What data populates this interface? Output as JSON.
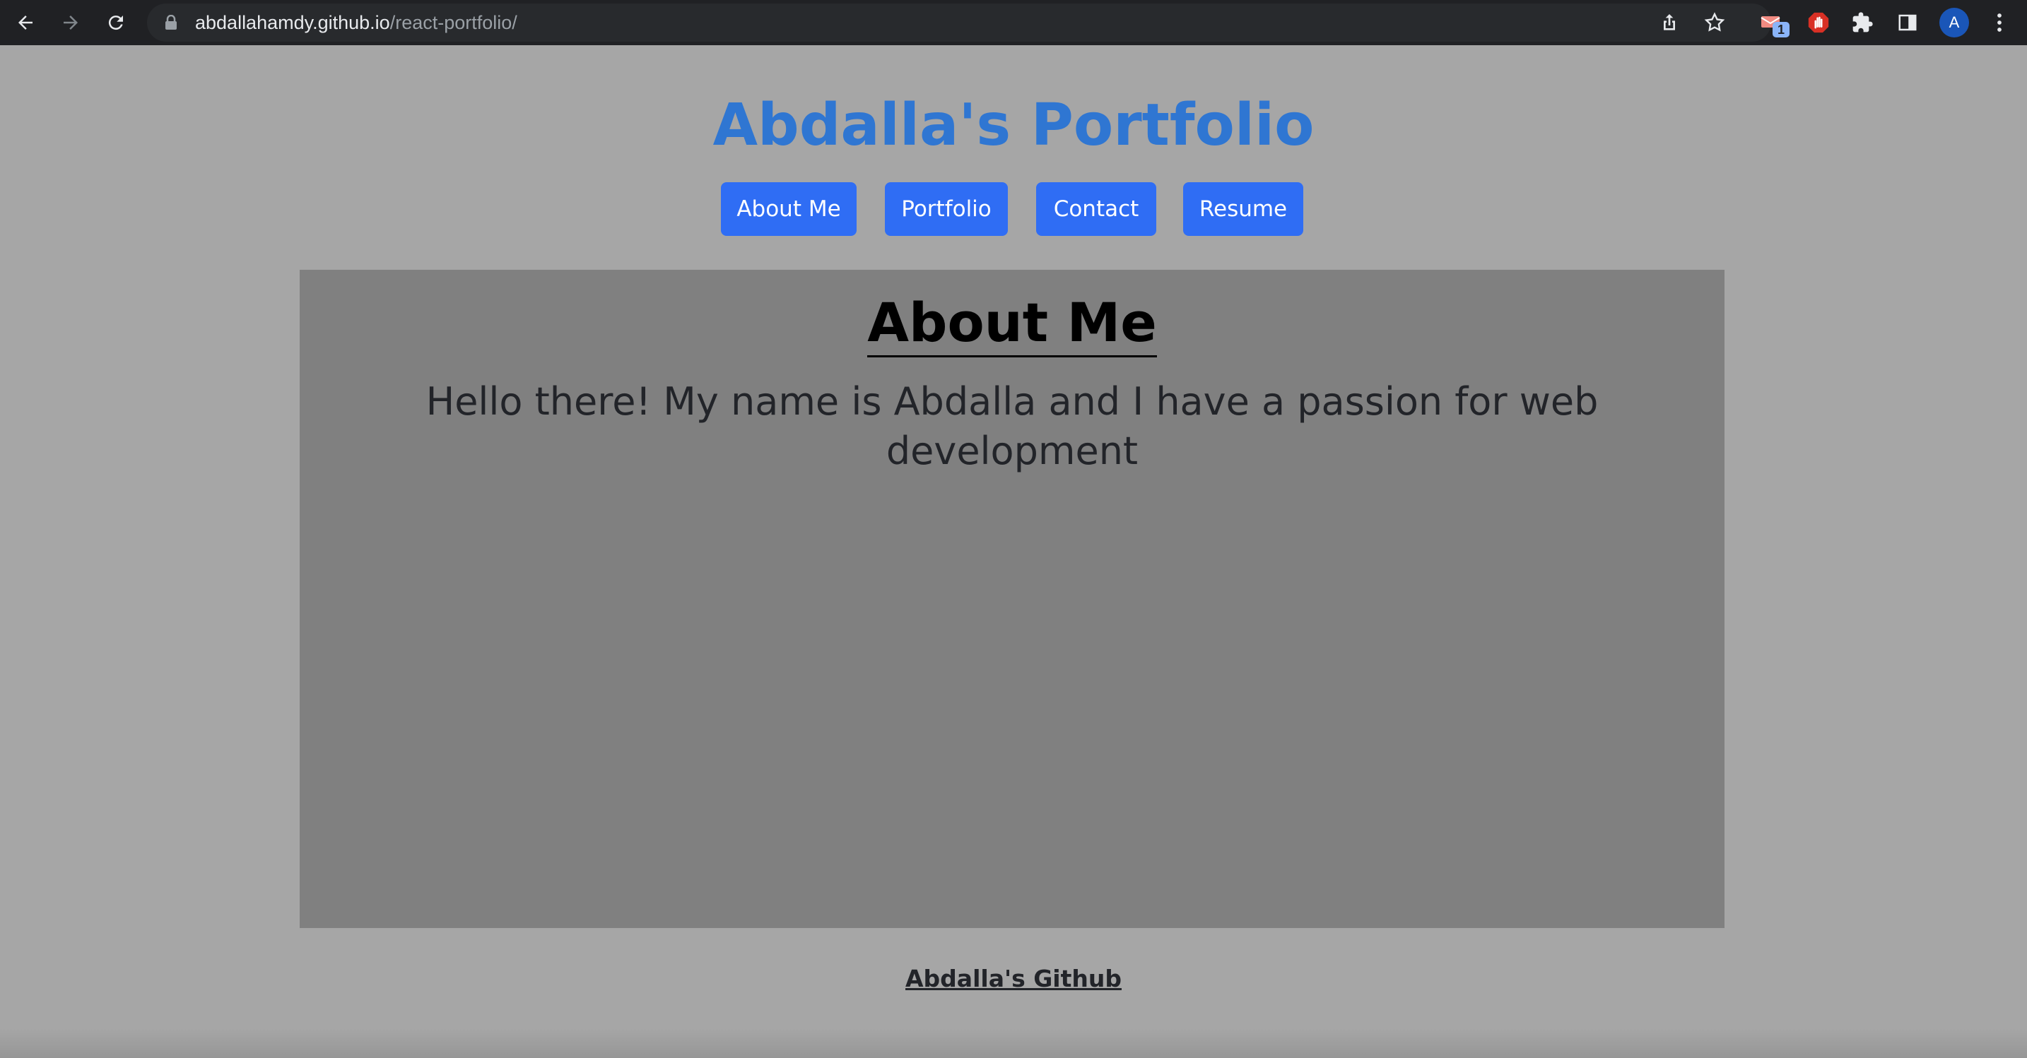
{
  "browser": {
    "url_host": "abdallahamdy.github.io",
    "url_path": "/react-portfolio/",
    "extension_badge": "1",
    "profile_initial": "A"
  },
  "page": {
    "title": "Abdalla's Portfolio",
    "nav": [
      {
        "label": "About Me"
      },
      {
        "label": "Portfolio"
      },
      {
        "label": "Contact"
      },
      {
        "label": "Resume"
      }
    ],
    "section": {
      "heading": "About Me",
      "text": "Hello there! My name is Abdalla and I have a passion for web development"
    },
    "footer_link": "Abdalla's Github"
  },
  "colors": {
    "background": "#a6a6a6",
    "panel": "#808080",
    "title": "#2f76d2",
    "button": "#2f6df4",
    "chrome": "#202124"
  },
  "icons": [
    "back-icon",
    "forward-icon",
    "reload-icon",
    "lock-icon",
    "share-icon",
    "star-icon",
    "extension-icon",
    "adblock-icon",
    "puzzle-icon",
    "side-panel-icon",
    "menu-icon"
  ]
}
